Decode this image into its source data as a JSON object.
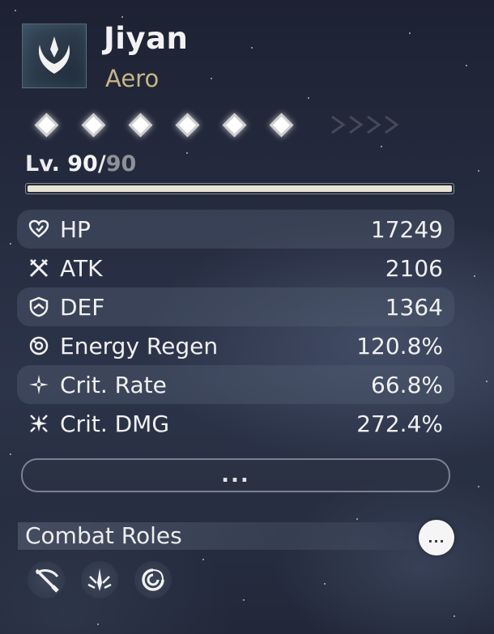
{
  "character": {
    "name": "Jiyan",
    "element": "Aero"
  },
  "sequence": {
    "nodes": [
      "active",
      "active",
      "active",
      "active",
      "active",
      "active"
    ]
  },
  "level": {
    "label": "Lv. ",
    "current": "90",
    "separator": "/",
    "max": "90",
    "progress": 1.0
  },
  "stats": [
    {
      "icon": "heart-icon",
      "label": "HP",
      "value": "17249"
    },
    {
      "icon": "crossed-swords-icon",
      "label": "ATK",
      "value": "2106"
    },
    {
      "icon": "shield-icon",
      "label": "DEF",
      "value": "1364"
    },
    {
      "icon": "energy-regen-icon",
      "label": "Energy Regen",
      "value": "120.8%"
    },
    {
      "icon": "crit-rate-star-icon",
      "label": "Crit. Rate",
      "value": "66.8%"
    },
    {
      "icon": "crit-dmg-sparkle-icon",
      "label": "Crit. DMG",
      "value": "272.4%"
    }
  ],
  "more_button": {
    "label": "..."
  },
  "combat_roles": {
    "title": "Combat Roles",
    "more_label": "...",
    "roles": [
      {
        "icon": "slash-role-icon"
      },
      {
        "icon": "blade-dive-role-icon"
      },
      {
        "icon": "aero-swirl-role-icon"
      }
    ]
  },
  "colors": {
    "element_text": "#c7b487",
    "level_max": "#8e9297",
    "xp_fill": "#e8e4d4"
  }
}
